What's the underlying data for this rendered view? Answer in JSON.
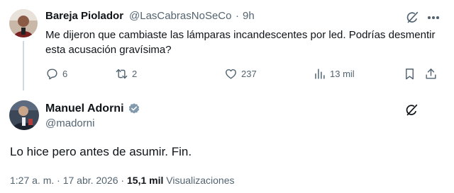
{
  "reply_tweet": {
    "author_name": "Bareja Piolador",
    "handle": "@LasCabrasNoSeCo",
    "separator": "·",
    "time": "9h",
    "text": "Me dijeron que cambiaste las lámparas incandescentes por led. Podrías desmentir esta acusación gravísima?",
    "actions": {
      "replies": "6",
      "retweets": "2",
      "likes": "237",
      "views": "13 mil"
    }
  },
  "main_tweet": {
    "author_name": "Manuel Adorni",
    "handle": "@madorni",
    "verified": true,
    "text": "Lo hice pero antes de asumir. Fin.",
    "timestamp": "1:27 a. m. · 17 abr. 2026 · ",
    "views_count": "15,1 mil",
    "views_label": " Visualizaciones"
  },
  "colors": {
    "text_primary": "#0f1419",
    "text_secondary": "#536471",
    "verified": "#829aab",
    "thread_line": "#cfd9de"
  },
  "icons": [
    "grok-icon",
    "more-icon",
    "reply-icon",
    "retweet-icon",
    "like-icon",
    "views-icon",
    "bookmark-icon",
    "share-icon",
    "verified-badge-icon"
  ]
}
